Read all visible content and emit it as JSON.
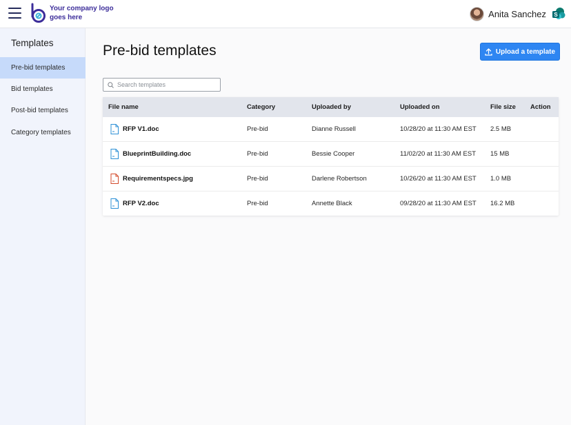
{
  "header": {
    "logo_text": "Your company logo goes here",
    "user_name": "Anita Sanchez"
  },
  "sidebar": {
    "title": "Templates",
    "items": [
      {
        "label": "Pre-bid templates",
        "active": true
      },
      {
        "label": "Bid templates",
        "active": false
      },
      {
        "label": "Post-bid templates",
        "active": false
      },
      {
        "label": "Category templates",
        "active": false
      }
    ]
  },
  "main": {
    "title": "Pre-bid templates",
    "upload_label": "Upload a template",
    "search_placeholder": "Search templates",
    "columns": {
      "file_name": "File name",
      "category": "Category",
      "uploaded_by": "Uploaded by",
      "uploaded_on": "Uploaded on",
      "file_size": "File size",
      "action": "Action"
    },
    "rows": [
      {
        "file_name": "RFP V1.doc",
        "category": "Pre-bid",
        "uploaded_by": "Dianne Russell",
        "uploaded_on": "10/28/20 at 11:30 AM EST",
        "file_size": "2.5 MB",
        "icon": "doc-file-icon"
      },
      {
        "file_name": "BlueprintBuilding.doc",
        "category": "Pre-bid",
        "uploaded_by": "Bessie Cooper",
        "uploaded_on": "11/02/20 at 11:30 AM EST",
        "file_size": "15 MB",
        "icon": "doc-file-icon"
      },
      {
        "file_name": "Requirementspecs.jpg",
        "category": "Pre-bid",
        "uploaded_by": "Darlene Robertson",
        "uploaded_on": "10/26/20 at 11:30 AM EST",
        "file_size": "1.0 MB",
        "icon": "image-file-icon"
      },
      {
        "file_name": "RFP V2.doc",
        "category": "Pre-bid",
        "uploaded_by": "Annette Black",
        "uploaded_on": "09/28/20 at 11:30 AM EST",
        "file_size": "16.2 MB",
        "icon": "doc-file-icon"
      }
    ]
  },
  "colors": {
    "accent": "#2e86f2",
    "sidebar_active": "#c6dafa",
    "doc_icon": "#2b8fd6",
    "image_icon": "#d34a2a",
    "logo": "#3c2d9a"
  }
}
